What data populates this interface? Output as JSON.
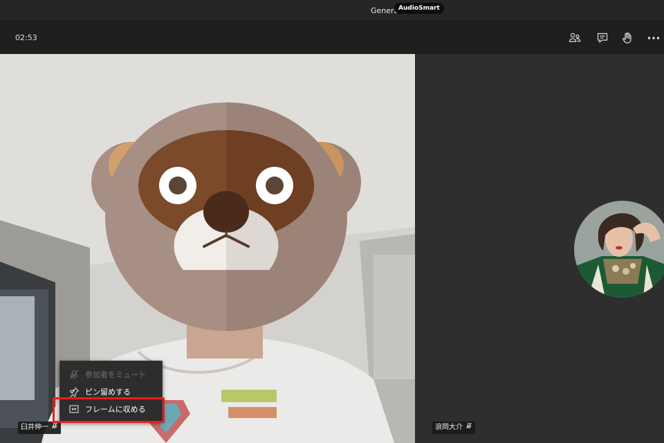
{
  "window": {
    "title": "General",
    "badge": "AudioSmart"
  },
  "meeting_bar": {
    "timer": "02:53",
    "icons": [
      "participants-icon",
      "chat-icon",
      "raise-hand-icon",
      "more-options-icon"
    ]
  },
  "participants": {
    "main": {
      "name": "臼井伸一"
    },
    "side": {
      "name": "浪岡大介"
    }
  },
  "context_menu": {
    "items": [
      {
        "label": "参加者をミュート",
        "icon": "mic-off-icon",
        "enabled": false
      },
      {
        "label": "ピン留めする",
        "icon": "pin-icon",
        "enabled": true
      },
      {
        "label": "フレームに収める",
        "icon": "fit-frame-icon",
        "enabled": true,
        "highlighted": true
      }
    ]
  },
  "colors": {
    "highlight": "#e5201d",
    "menu_bg": "#2d2d2d",
    "bar_bg": "#1f1f1f"
  }
}
